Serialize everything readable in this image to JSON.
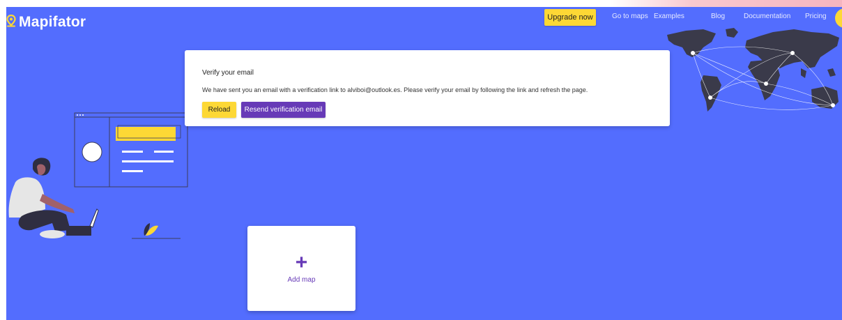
{
  "header": {
    "logo_text": "Mapifator",
    "upgrade_label": "Upgrade now",
    "nav": [
      {
        "label": "Go to maps"
      },
      {
        "label": "Examples"
      },
      {
        "label": "Blog"
      },
      {
        "label": "Documentation"
      },
      {
        "label": "Pricing"
      }
    ]
  },
  "verify": {
    "title": "Verify your email",
    "message": "We have sent you an email with a verification link to alviboi@outlook.es. Please verify your email by following the link and refresh the page.",
    "reload_label": "Reload",
    "resend_label": "Resend verification email"
  },
  "add_map": {
    "icon": "plus-icon",
    "label": "Add map"
  },
  "colors": {
    "background": "#536DFE",
    "accent_yellow": "#FDD835",
    "accent_purple": "#673AB7"
  }
}
